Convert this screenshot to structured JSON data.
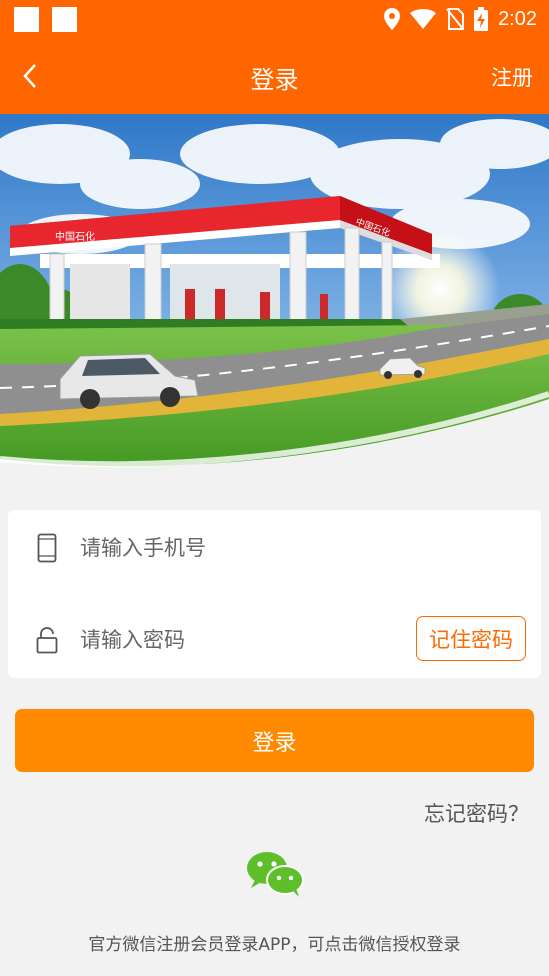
{
  "status_bar": {
    "time": "2:02",
    "icons": [
      "app-square-icon",
      "app-square-icon",
      "location-icon",
      "wifi-icon",
      "no-sim-icon",
      "battery-charging-icon"
    ]
  },
  "header": {
    "back_icon": "chevron-left-icon",
    "title": "登录",
    "register_label": "注册"
  },
  "banner": {
    "station_sign_text": "中国石化",
    "canopy_sign_text": "中国石化"
  },
  "login_form": {
    "phone": {
      "icon": "phone-icon",
      "value": "",
      "placeholder": "请输入手机号"
    },
    "password": {
      "icon": "lock-icon",
      "value": "",
      "placeholder": "请输入密码"
    },
    "remember_label": "记住密码"
  },
  "login_button_label": "登录",
  "forgot_password_label": "忘记密码？",
  "wechat": {
    "icon": "wechat-icon",
    "note": "官方微信注册会员登录APP，可点击微信授权登录"
  },
  "colors": {
    "primary": "#ff6600",
    "button": "#ff8a00",
    "background": "#f2f2f2",
    "wechat": "#5fbf2a"
  }
}
